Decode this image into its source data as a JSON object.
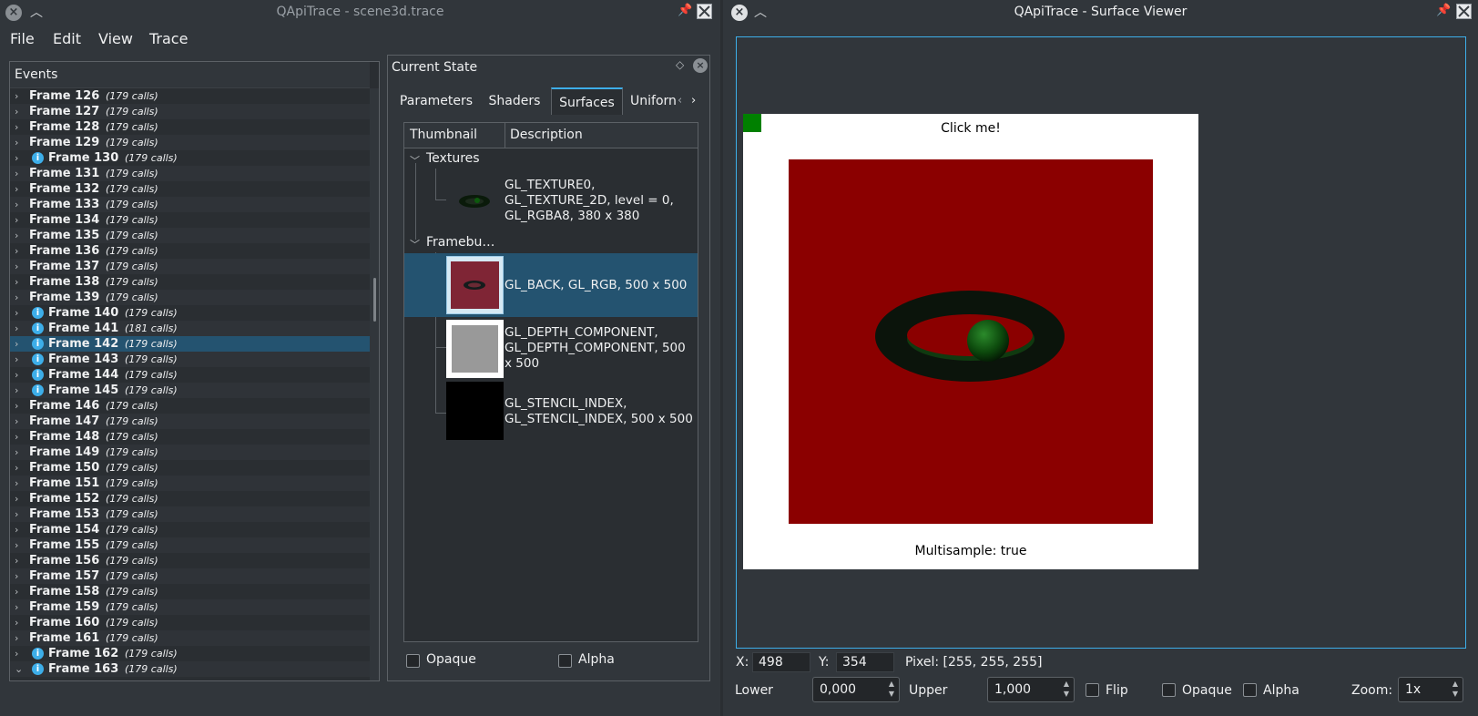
{
  "left_window": {
    "title": "QApiTrace - scene3d.trace",
    "menu": [
      "File",
      "Edit",
      "View",
      "Trace"
    ]
  },
  "events": {
    "title": "Events",
    "frames": [
      {
        "label": "Frame 126",
        "calls": "(179 calls)",
        "info": false
      },
      {
        "label": "Frame 127",
        "calls": "(179 calls)",
        "info": false
      },
      {
        "label": "Frame 128",
        "calls": "(179 calls)",
        "info": false
      },
      {
        "label": "Frame 129",
        "calls": "(179 calls)",
        "info": false
      },
      {
        "label": "Frame 130",
        "calls": "(179 calls)",
        "info": true
      },
      {
        "label": "Frame 131",
        "calls": "(179 calls)",
        "info": false
      },
      {
        "label": "Frame 132",
        "calls": "(179 calls)",
        "info": false
      },
      {
        "label": "Frame 133",
        "calls": "(179 calls)",
        "info": false
      },
      {
        "label": "Frame 134",
        "calls": "(179 calls)",
        "info": false
      },
      {
        "label": "Frame 135",
        "calls": "(179 calls)",
        "info": false
      },
      {
        "label": "Frame 136",
        "calls": "(179 calls)",
        "info": false
      },
      {
        "label": "Frame 137",
        "calls": "(179 calls)",
        "info": false
      },
      {
        "label": "Frame 138",
        "calls": "(179 calls)",
        "info": false
      },
      {
        "label": "Frame 139",
        "calls": "(179 calls)",
        "info": false
      },
      {
        "label": "Frame 140",
        "calls": "(179 calls)",
        "info": true
      },
      {
        "label": "Frame 141",
        "calls": "(181 calls)",
        "info": true
      },
      {
        "label": "Frame 142",
        "calls": "(179 calls)",
        "info": true,
        "selected": true
      },
      {
        "label": "Frame 143",
        "calls": "(179 calls)",
        "info": true
      },
      {
        "label": "Frame 144",
        "calls": "(179 calls)",
        "info": true
      },
      {
        "label": "Frame 145",
        "calls": "(179 calls)",
        "info": true
      },
      {
        "label": "Frame 146",
        "calls": "(179 calls)",
        "info": false
      },
      {
        "label": "Frame 147",
        "calls": "(179 calls)",
        "info": false
      },
      {
        "label": "Frame 148",
        "calls": "(179 calls)",
        "info": false
      },
      {
        "label": "Frame 149",
        "calls": "(179 calls)",
        "info": false
      },
      {
        "label": "Frame 150",
        "calls": "(179 calls)",
        "info": false
      },
      {
        "label": "Frame 151",
        "calls": "(179 calls)",
        "info": false
      },
      {
        "label": "Frame 152",
        "calls": "(179 calls)",
        "info": false
      },
      {
        "label": "Frame 153",
        "calls": "(179 calls)",
        "info": false
      },
      {
        "label": "Frame 154",
        "calls": "(179 calls)",
        "info": false
      },
      {
        "label": "Frame 155",
        "calls": "(179 calls)",
        "info": false
      },
      {
        "label": "Frame 156",
        "calls": "(179 calls)",
        "info": false
      },
      {
        "label": "Frame 157",
        "calls": "(179 calls)",
        "info": false
      },
      {
        "label": "Frame 158",
        "calls": "(179 calls)",
        "info": false
      },
      {
        "label": "Frame 159",
        "calls": "(179 calls)",
        "info": false
      },
      {
        "label": "Frame 160",
        "calls": "(179 calls)",
        "info": false
      },
      {
        "label": "Frame 161",
        "calls": "(179 calls)",
        "info": false
      },
      {
        "label": "Frame 162",
        "calls": "(179 calls)",
        "info": true
      },
      {
        "label": "Frame 163",
        "calls": "(179 calls)",
        "info": true,
        "expanded": true
      }
    ]
  },
  "current_state": {
    "title": "Current State",
    "tabs": [
      "Parameters",
      "Shaders",
      "Surfaces",
      "Uniforn"
    ],
    "active_tab": "Surfaces",
    "columns": [
      "Thumbnail",
      "Description"
    ],
    "groups": {
      "textures": "Textures",
      "framebuffers": "Framebu…"
    },
    "texture_desc": [
      "GL_TEXTURE0,",
      "GL_TEXTURE_2D, level = 0,",
      "GL_RGBA8, 380 x 380"
    ],
    "framebuffer_descs": [
      [
        "GL_BACK, GL_RGB, 500 x 500"
      ],
      [
        "GL_DEPTH_COMPONENT,",
        "GL_DEPTH_COMPONENT, 500",
        "x 500"
      ],
      [
        "GL_STENCIL_INDEX,",
        "GL_STENCIL_INDEX, 500 x 500"
      ]
    ],
    "opaque_label": "Opaque",
    "alpha_label": "Alpha"
  },
  "right_window": {
    "title": "QApiTrace - Surface Viewer"
  },
  "surface": {
    "click_label": "Click me!",
    "multisample_label": "Multisample: true",
    "colors": {
      "background": "#8b0000",
      "torus": "#0a1a0a",
      "sphere": "#0d5a0d",
      "corner": "#008000"
    }
  },
  "viewer_controls": {
    "x_label": "X:",
    "x_value": "498",
    "y_label": "Y:",
    "y_value": "354",
    "pixel_text": "Pixel: [255, 255, 255]",
    "lower_label": "Lower",
    "lower_value": "0,000",
    "upper_label": "Upper",
    "upper_value": "1,000",
    "flip_label": "Flip",
    "opaque_label": "Opaque",
    "alpha_label": "Alpha",
    "zoom_label": "Zoom:",
    "zoom_value": "1x"
  }
}
